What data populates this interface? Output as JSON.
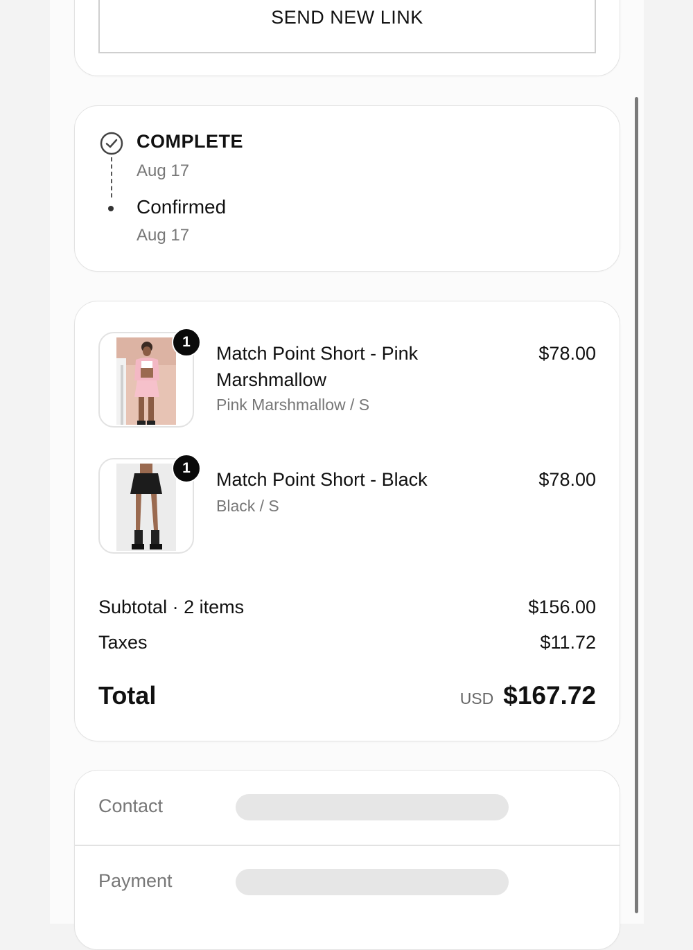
{
  "top_card": {
    "send_link_label": "SEND NEW LINK"
  },
  "status": {
    "title": "COMPLETE",
    "title_date": "Aug 17",
    "sub": "Confirmed",
    "sub_date": "Aug 17"
  },
  "items": [
    {
      "name": "Match Point Short - Pink Marshmallow",
      "variant": "Pink Marshmallow / S",
      "price": "$78.00",
      "qty": "1",
      "icon": "product-photo-pink-shorts"
    },
    {
      "name": "Match Point Short - Black",
      "variant": "Black / S",
      "price": "$78.00",
      "qty": "1",
      "icon": "product-photo-black-shorts"
    }
  ],
  "summary": {
    "subtotal_label": "Subtotal · 2 items",
    "subtotal_value": "$156.00",
    "taxes_label": "Taxes",
    "taxes_value": "$11.72",
    "total_label": "Total",
    "currency": "USD",
    "total_value": "$167.72"
  },
  "info": {
    "contact_label": "Contact",
    "payment_label": "Payment"
  },
  "colors": {
    "accent": "#111111",
    "muted_text": "#777777",
    "placeholder": "#e6e6e6"
  }
}
